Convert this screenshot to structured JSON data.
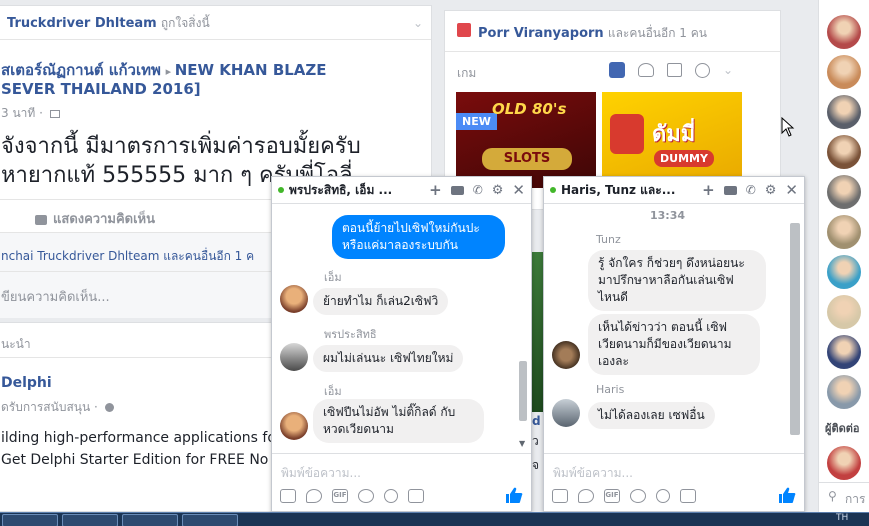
{
  "post": {
    "author": "Truckdriver Dhlteam",
    "author_suffix": "ถูกใจสิ่งนี้",
    "from_name": "สเตอร์ณัฏกานต์ แก้วเทพ",
    "to_name": "NEW KHAN BLAZE",
    "to_name2": "SEVER THAILAND 2016]",
    "time": "3 นาที ·",
    "text_line1": "จังจากนี้ มีมาตรการเพิ่มค่ารอบมั้ยครับ",
    "text_line2": "หายากแท้ 555555 มาก ๆ ครับพี่โอลี่",
    "action_comment": "แสดงความคิดเห็น",
    "liker_name": "nchai Truckdriver Dhlteam",
    "liker_suffix": "และคนอื่นอีก 1 ค",
    "comment_placeholder": "ขียนความคิดเห็น..."
  },
  "suggested": {
    "header": "นะนำ",
    "page_name": "Delphi",
    "sponsored": "ดรับการสนับสนุน ·",
    "line1": "ilding high-performance applications fo",
    "line2": "Get Delphi Starter Edition for FREE No"
  },
  "games": {
    "friend": "Porr Viranyaporn",
    "friend_suffix": "และคนอื่นอีก 1 คน",
    "tab_label": "เกม",
    "game1_badge": "NEW",
    "game1_title": "SLOTS",
    "game1_small": "OLD 80's",
    "game2_title": "ดัมมี่",
    "game2_sub": "DUMMY",
    "partial1": "d",
    "partial2": "ว",
    "partial3": "จ"
  },
  "chat1": {
    "title": "พรประสิทธิ, เอ็ม ...",
    "sent_line1": "ตอนนี้ย้ายไปเซิฟใหม่กันปะ",
    "sent_line2": "หรือแค่มาลองระบบกัน",
    "m1_sender": "เอ็ม",
    "m1_text": "ย้ายทำไม ก็เล่น2เซิฟวิ",
    "m2_sender": "พรประสิทธิ",
    "m2_text": "ผมไม่เล่นนะ เซิฟไทยใหม่",
    "m3_sender": "เอ็ม",
    "m3_line1": "เซิฟปีนไม่อัพ ไม่ติ๊กิลด์ กับ",
    "m3_line2": "หวดเวียดนาม",
    "placeholder": "พิมพ์ข้อความ..."
  },
  "chat2": {
    "title": "Haris, Tunz และ...",
    "timestamp": "13:34",
    "m1_sender": "Tunz",
    "m1_line1": "รู้ จักใคร ก็ช่วยๆ ดึงหน่อยนะ",
    "m1_line2": "มาปรึกษาหาลือกันเล่นเซิฟ",
    "m1_line3": "ไหนดี",
    "m2_line1": "เห็นได้ข่าวว่า  ตอนนี้  เซิฟ",
    "m2_line2": "เวียดนามก็มีของเวียดนาม",
    "m2_line3": "เองละ",
    "m3_sender": "Haris",
    "m3_text": "ไม่ได้ลองเลย เซฟอื่น",
    "placeholder": "พิมพ์ข้อความ..."
  },
  "sidebar": {
    "section_label": "ผู้ติดต่อ",
    "search_placeholder": "การ",
    "avatar_colors": [
      "#b44a4a",
      "#c98b5a",
      "#5a5f6a",
      "#7a5238",
      "#6e6e6e",
      "#a09070",
      "#3aa0c8",
      "#d6c8a8",
      "#334477",
      "#8899aa",
      "#c24040"
    ]
  },
  "taskbar": {
    "clock_hint": "TH"
  },
  "colors": {
    "fb_blue": "#365899",
    "messenger_blue": "#0084ff",
    "online_green": "#42b72a"
  }
}
